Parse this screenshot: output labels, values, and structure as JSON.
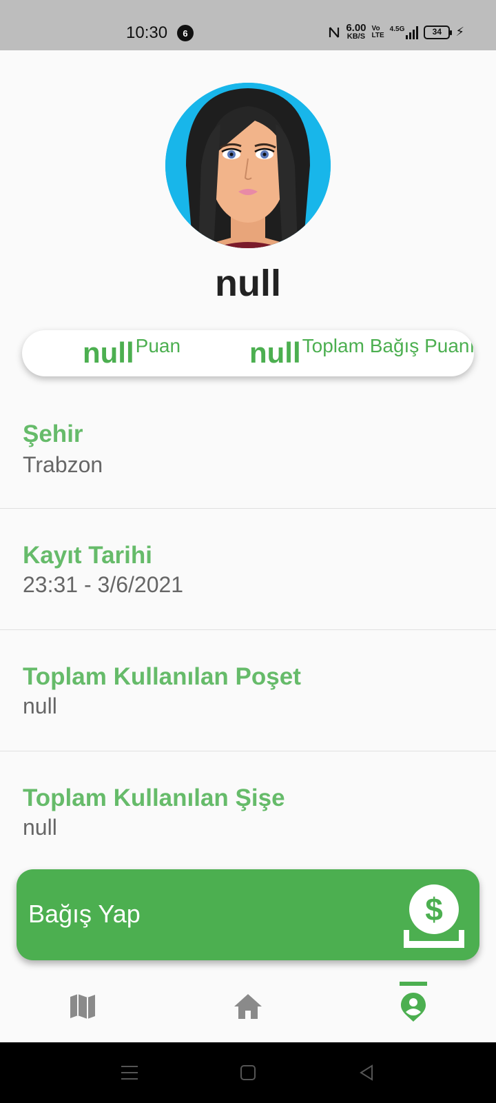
{
  "status_bar": {
    "time": "10:30",
    "notification_count": "6",
    "net_speed_value": "6.00",
    "net_speed_unit": "KB/S",
    "volte_top": "Vo",
    "volte_bottom": "LTE",
    "network": "4.5G",
    "battery": "34"
  },
  "profile": {
    "name": "null",
    "avatar_icon": "female-avatar-illustration"
  },
  "stats": {
    "points_value": "null",
    "points_label": "Puan",
    "donation_value": "null",
    "donation_label": "Toplam Bağış Puanı"
  },
  "info": [
    {
      "title": "Şehir",
      "value": "Trabzon"
    },
    {
      "title": "Kayıt Tarihi",
      "value": "23:31 - 3/6/2021"
    },
    {
      "title": "Toplam Kullanılan Poşet",
      "value": "null"
    },
    {
      "title": "Toplam Kullanılan Şişe",
      "value": "null"
    }
  ],
  "donate": {
    "label": "Bağış Yap",
    "icon": "donate-money-icon"
  },
  "bottom_nav": {
    "items": [
      "map-icon",
      "home-icon",
      "profile-icon"
    ],
    "active": "profile-icon",
    "accent": "#4caf50"
  },
  "colors": {
    "accent": "#4caf50",
    "title_green": "#66bb6a",
    "avatar_bg": "#18b6ea"
  }
}
